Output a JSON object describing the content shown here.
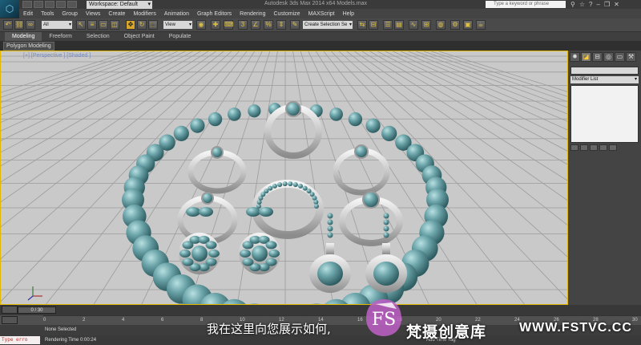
{
  "window": {
    "title": "Autodesk 3ds Max  2014 x64      Models.max",
    "workspace": "Workspace: Default",
    "search_placeholder": "Type a keyword or phrase"
  },
  "menu": [
    "Edit",
    "Tools",
    "Group",
    "Views",
    "Create",
    "Modifiers",
    "Animation",
    "Graph Editors",
    "Rendering",
    "Customize",
    "MAXScript",
    "Help"
  ],
  "toolbar": {
    "filter_select": "All",
    "reference_select": "View",
    "selection_set": "Create Selection Se"
  },
  "ribbon": {
    "tabs": [
      "Modeling",
      "Freeform",
      "Selection",
      "Object Paint",
      "Populate"
    ],
    "panel_label": "Polygon Modeling"
  },
  "viewport": {
    "label": "[+] [Perspective ] [Shaded ]"
  },
  "command_panel": {
    "modifier_list": "Modifier List"
  },
  "timeline": {
    "slider": "0 / 30",
    "ticks": [
      "0",
      "2",
      "4",
      "6",
      "8",
      "10",
      "12",
      "14",
      "16",
      "18",
      "20",
      "22",
      "24",
      "26",
      "28",
      "30"
    ]
  },
  "status": {
    "maxscript": "Type erro",
    "selection": "None Selected",
    "render_time": "Rendering Time  0:00:24",
    "add_time_tag": "Add Time Tag"
  },
  "overlay": {
    "subtitle": "我在这里向您展示如何,",
    "brand_name": "梵摄创意库",
    "brand_url": "WWW.FSTVC.CC",
    "brand_logo_text": "FS"
  },
  "colors": {
    "bead": "#6aa3a8",
    "metal": "#d6d6d6",
    "viewport_bg": "#c9c9c9",
    "active_border": "#e3b800"
  }
}
